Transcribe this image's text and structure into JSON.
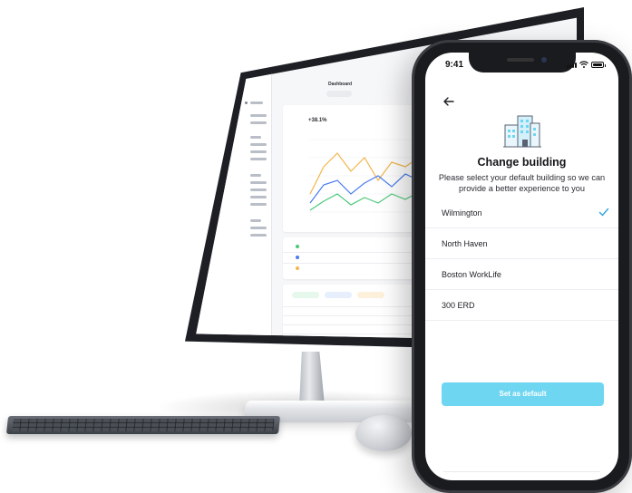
{
  "colors": {
    "accent": "#6fd6f2",
    "check": "#3aa6de",
    "phone_frame": "#1a1b1e",
    "monitor_bezel": "#1d1f24",
    "chart_line_1": "#f2b64c",
    "chart_line_2": "#4a7cf0",
    "chart_line_3": "#4bc87a"
  },
  "phone": {
    "status_time": "9:41",
    "back_icon": "back-arrow-icon",
    "header_icon": "building-icon",
    "title": "Change building",
    "subtitle": "Please select your default building so we can provide a better experience to you",
    "buildings": [
      {
        "label": "Wilmington",
        "selected": true
      },
      {
        "label": "North Haven",
        "selected": false
      },
      {
        "label": "Boston WorkLife",
        "selected": false
      },
      {
        "label": "300 ERD",
        "selected": false
      }
    ],
    "cta_label": "Set as default"
  },
  "desktop": {
    "header_title": "Dashboard",
    "chart_value": "+38.1%"
  }
}
